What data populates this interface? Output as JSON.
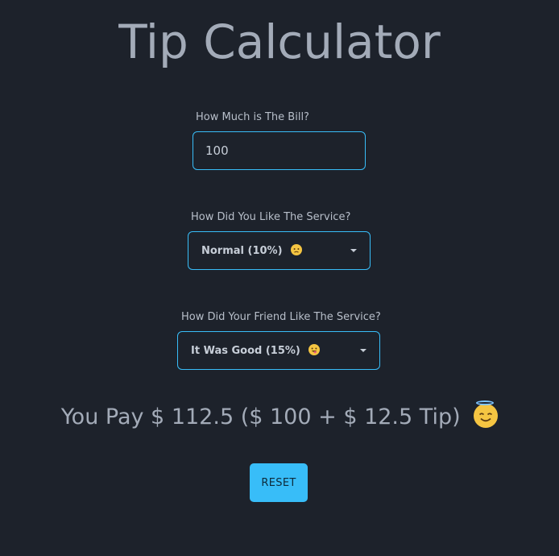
{
  "page": {
    "title": "Tip Calculator"
  },
  "bill": {
    "label": "How Much is The Bill?",
    "value": "100"
  },
  "service": {
    "label": "How Did You Like The Service?",
    "selected": "Normal (10%)",
    "emoji_icon": "disappointed-face-icon"
  },
  "friend_service": {
    "label": "How Did Your Friend Like The Service?",
    "selected": "It Was Good (15%)",
    "emoji_icon": "grinning-tongue-face-icon"
  },
  "result": {
    "text": "You Pay $ 112.5 ($ 100 + $ 12.5 Tip)",
    "emoji_icon": "smiling-angel-face-icon"
  },
  "reset": {
    "label": "RESET"
  },
  "colors": {
    "background": "#1d222b",
    "accent": "#38bdf8",
    "text": "#a3abb8"
  }
}
